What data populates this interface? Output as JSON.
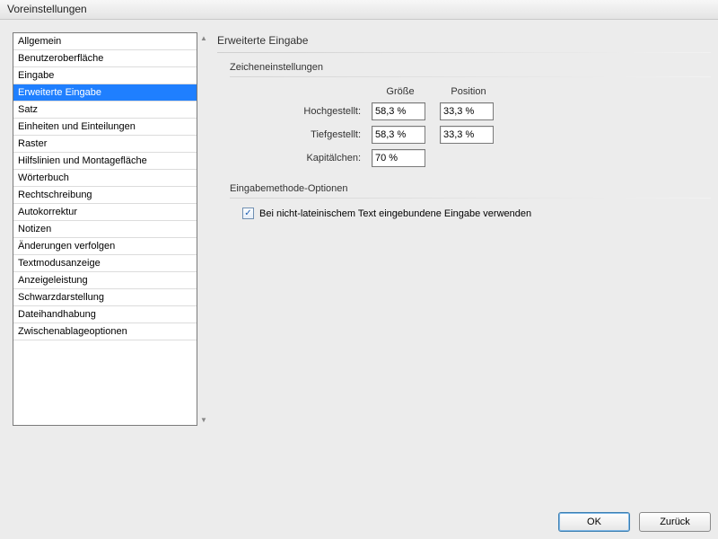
{
  "window": {
    "title": "Voreinstellungen"
  },
  "sidebar": {
    "items": [
      "Allgemein",
      "Benutzeroberfläche",
      "Eingabe",
      "Erweiterte Eingabe",
      "Satz",
      "Einheiten und Einteilungen",
      "Raster",
      "Hilfslinien und Montagefläche",
      "Wörterbuch",
      "Rechtschreibung",
      "Autokorrektur",
      "Notizen",
      "Änderungen verfolgen",
      "Textmodusanzeige",
      "Anzeigeleistung",
      "Schwarzdarstellung",
      "Dateihandhabung",
      "Zwischenablageoptionen"
    ],
    "selected_index": 3
  },
  "panel": {
    "title": "Erweiterte Eingabe",
    "group_chars": {
      "title": "Zeicheneinstellungen",
      "col_size": "Größe",
      "col_position": "Position",
      "row_super": "Hochgestellt:",
      "row_sub": "Tiefgestellt:",
      "row_smallcaps": "Kapitälchen:",
      "super_size": "58,3 %",
      "super_pos": "33,3 %",
      "sub_size": "58,3 %",
      "sub_pos": "33,3 %",
      "smallcaps_size": "70 %"
    },
    "group_input": {
      "title": "Eingabemethode-Optionen",
      "checkbox_label": "Bei nicht-lateinischem Text eingebundene Eingabe verwenden",
      "checkbox_checked": true
    }
  },
  "buttons": {
    "ok": "OK",
    "back": "Zurück"
  }
}
